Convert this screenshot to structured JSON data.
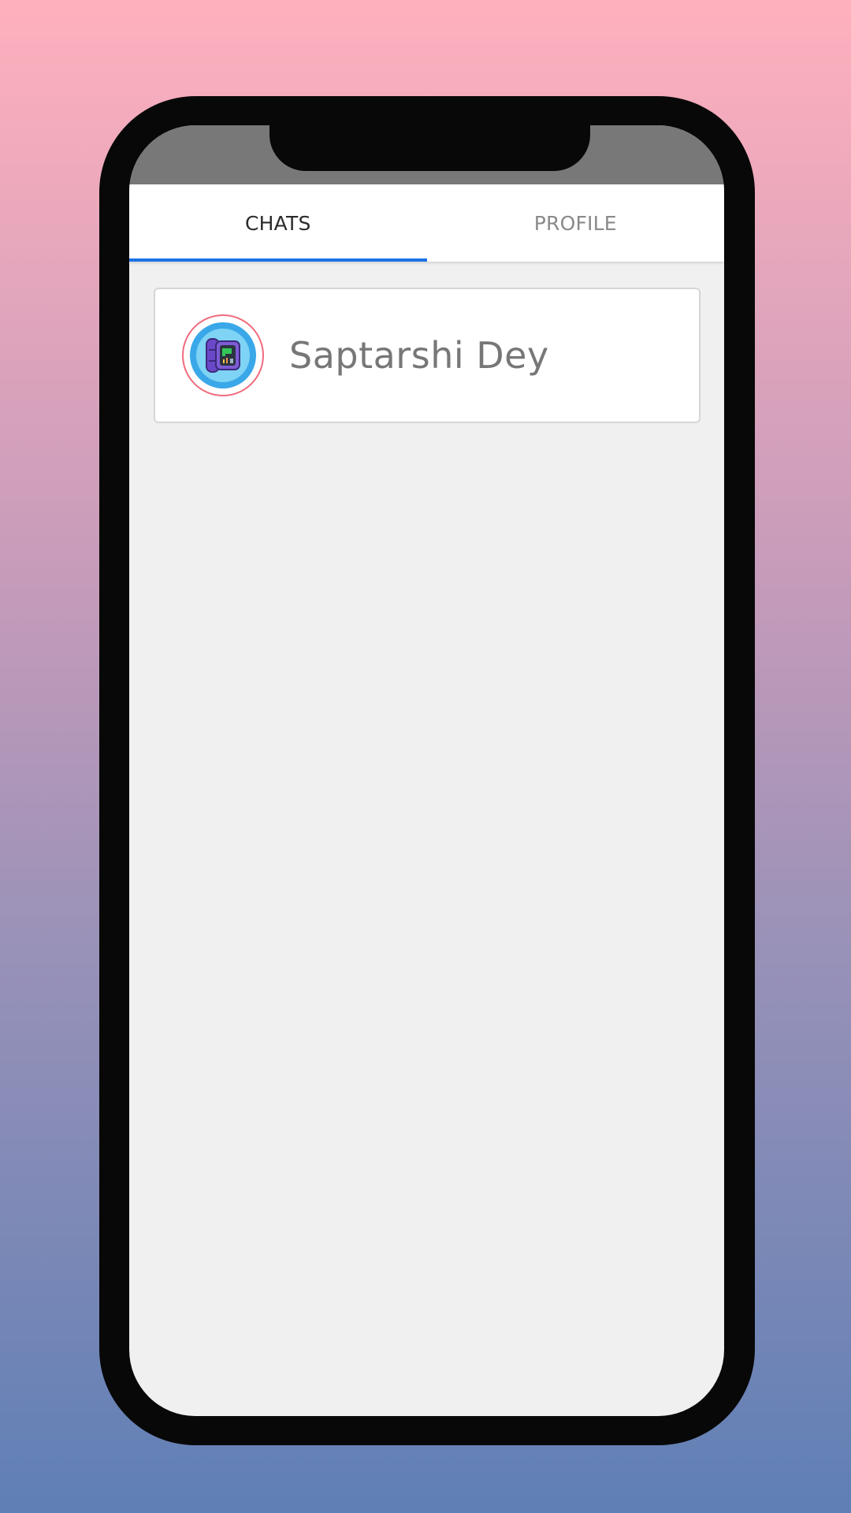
{
  "tabs": {
    "chats_label": "CHATS",
    "profile_label": "PROFILE",
    "active": "chats"
  },
  "chats": [
    {
      "name": "Saptarshi Dey",
      "avatar_icon": "smartwatch-icon"
    }
  ],
  "colors": {
    "accent": "#1a73e8",
    "status_bar": "#787878",
    "avatar_ring": "#f06b7e"
  }
}
